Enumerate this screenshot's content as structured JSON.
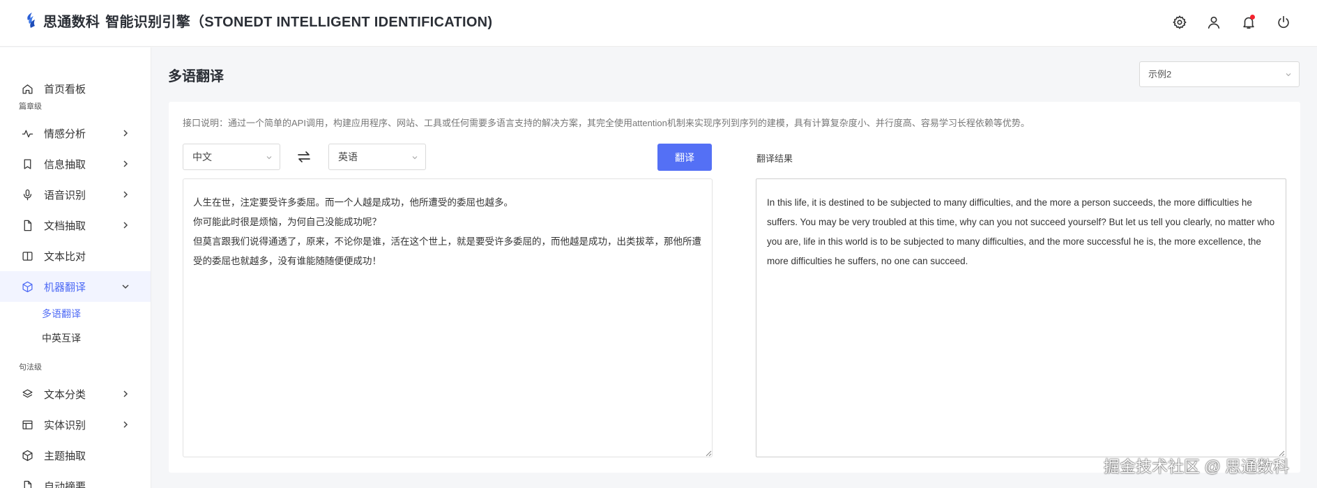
{
  "header": {
    "brand_name": "思通数科",
    "brand_subtitle": "智能识别引擎（STONEDT INTELLIGENT IDENTIFICATION)",
    "icons": [
      "gear-icon",
      "user-icon",
      "bell-icon",
      "power-icon"
    ],
    "notification_dot_color": "#f5222d"
  },
  "sidebar": {
    "groups": {
      "chapter": "篇章级",
      "sentence": "句法级"
    },
    "items": [
      {
        "label": "首页看板",
        "icon": "home-icon"
      },
      {
        "label": "情感分析",
        "icon": "pulse-icon"
      },
      {
        "label": "信息抽取",
        "icon": "bookmark-icon"
      },
      {
        "label": "语音识别",
        "icon": "microphone-icon"
      },
      {
        "label": "文档抽取",
        "icon": "document-icon"
      },
      {
        "label": "文本比对",
        "icon": "compare-icon"
      },
      {
        "label": "机器翻译",
        "icon": "cube-icon"
      },
      {
        "label": "文本分类",
        "icon": "layers-icon"
      },
      {
        "label": "实体识别",
        "icon": "table-icon"
      },
      {
        "label": "主题抽取",
        "icon": "box-icon"
      },
      {
        "label": "自动摘要",
        "icon": "document-icon"
      }
    ],
    "sub_items": [
      {
        "label": "多语翻译",
        "active": true
      },
      {
        "label": "中英互译",
        "active": false
      }
    ],
    "accent_color": "#4f6bf5"
  },
  "main": {
    "page_title": "多语翻译",
    "example_select": "示例2",
    "description": "接口说明：通过一个简单的API调用，构建应用程序、网站、工具或任何需要多语言支持的解决方案，其完全使用attention机制来实现序列到序列的建模，具有计算复杂度小、并行度高、容易学习长程依赖等优势。",
    "source_language": "中文",
    "target_language": "英语",
    "translate_button": "翻译",
    "result_label": "翻译结果",
    "source_text": "人生在世，注定要受许多委屈。而一个人越是成功，他所遭受的委屈也越多。\n你可能此时很是烦恼，为何自己没能成功呢？\n但莫言跟我们说得通透了，原来，不论你是谁，活在这个世上，就是要受许多委屈的，而他越是成功，出类拔萃，那他所遭受的委屈也就越多，没有谁能随随便便成功！",
    "result_text": "In this life, it is destined to be subjected to many difficulties, and the more a person succeeds, the more difficulties he suffers. You may be very troubled at this time, why can you not succeed yourself? But let us tell you clearly, no matter who you are, life in this world is to be subjected to many difficulties, and the more successful he is, the more excellence, the more difficulties he suffers, no one can succeed.",
    "button_color": "#5470f5"
  },
  "watermark": "掘金技术社区 @ 思通数科"
}
